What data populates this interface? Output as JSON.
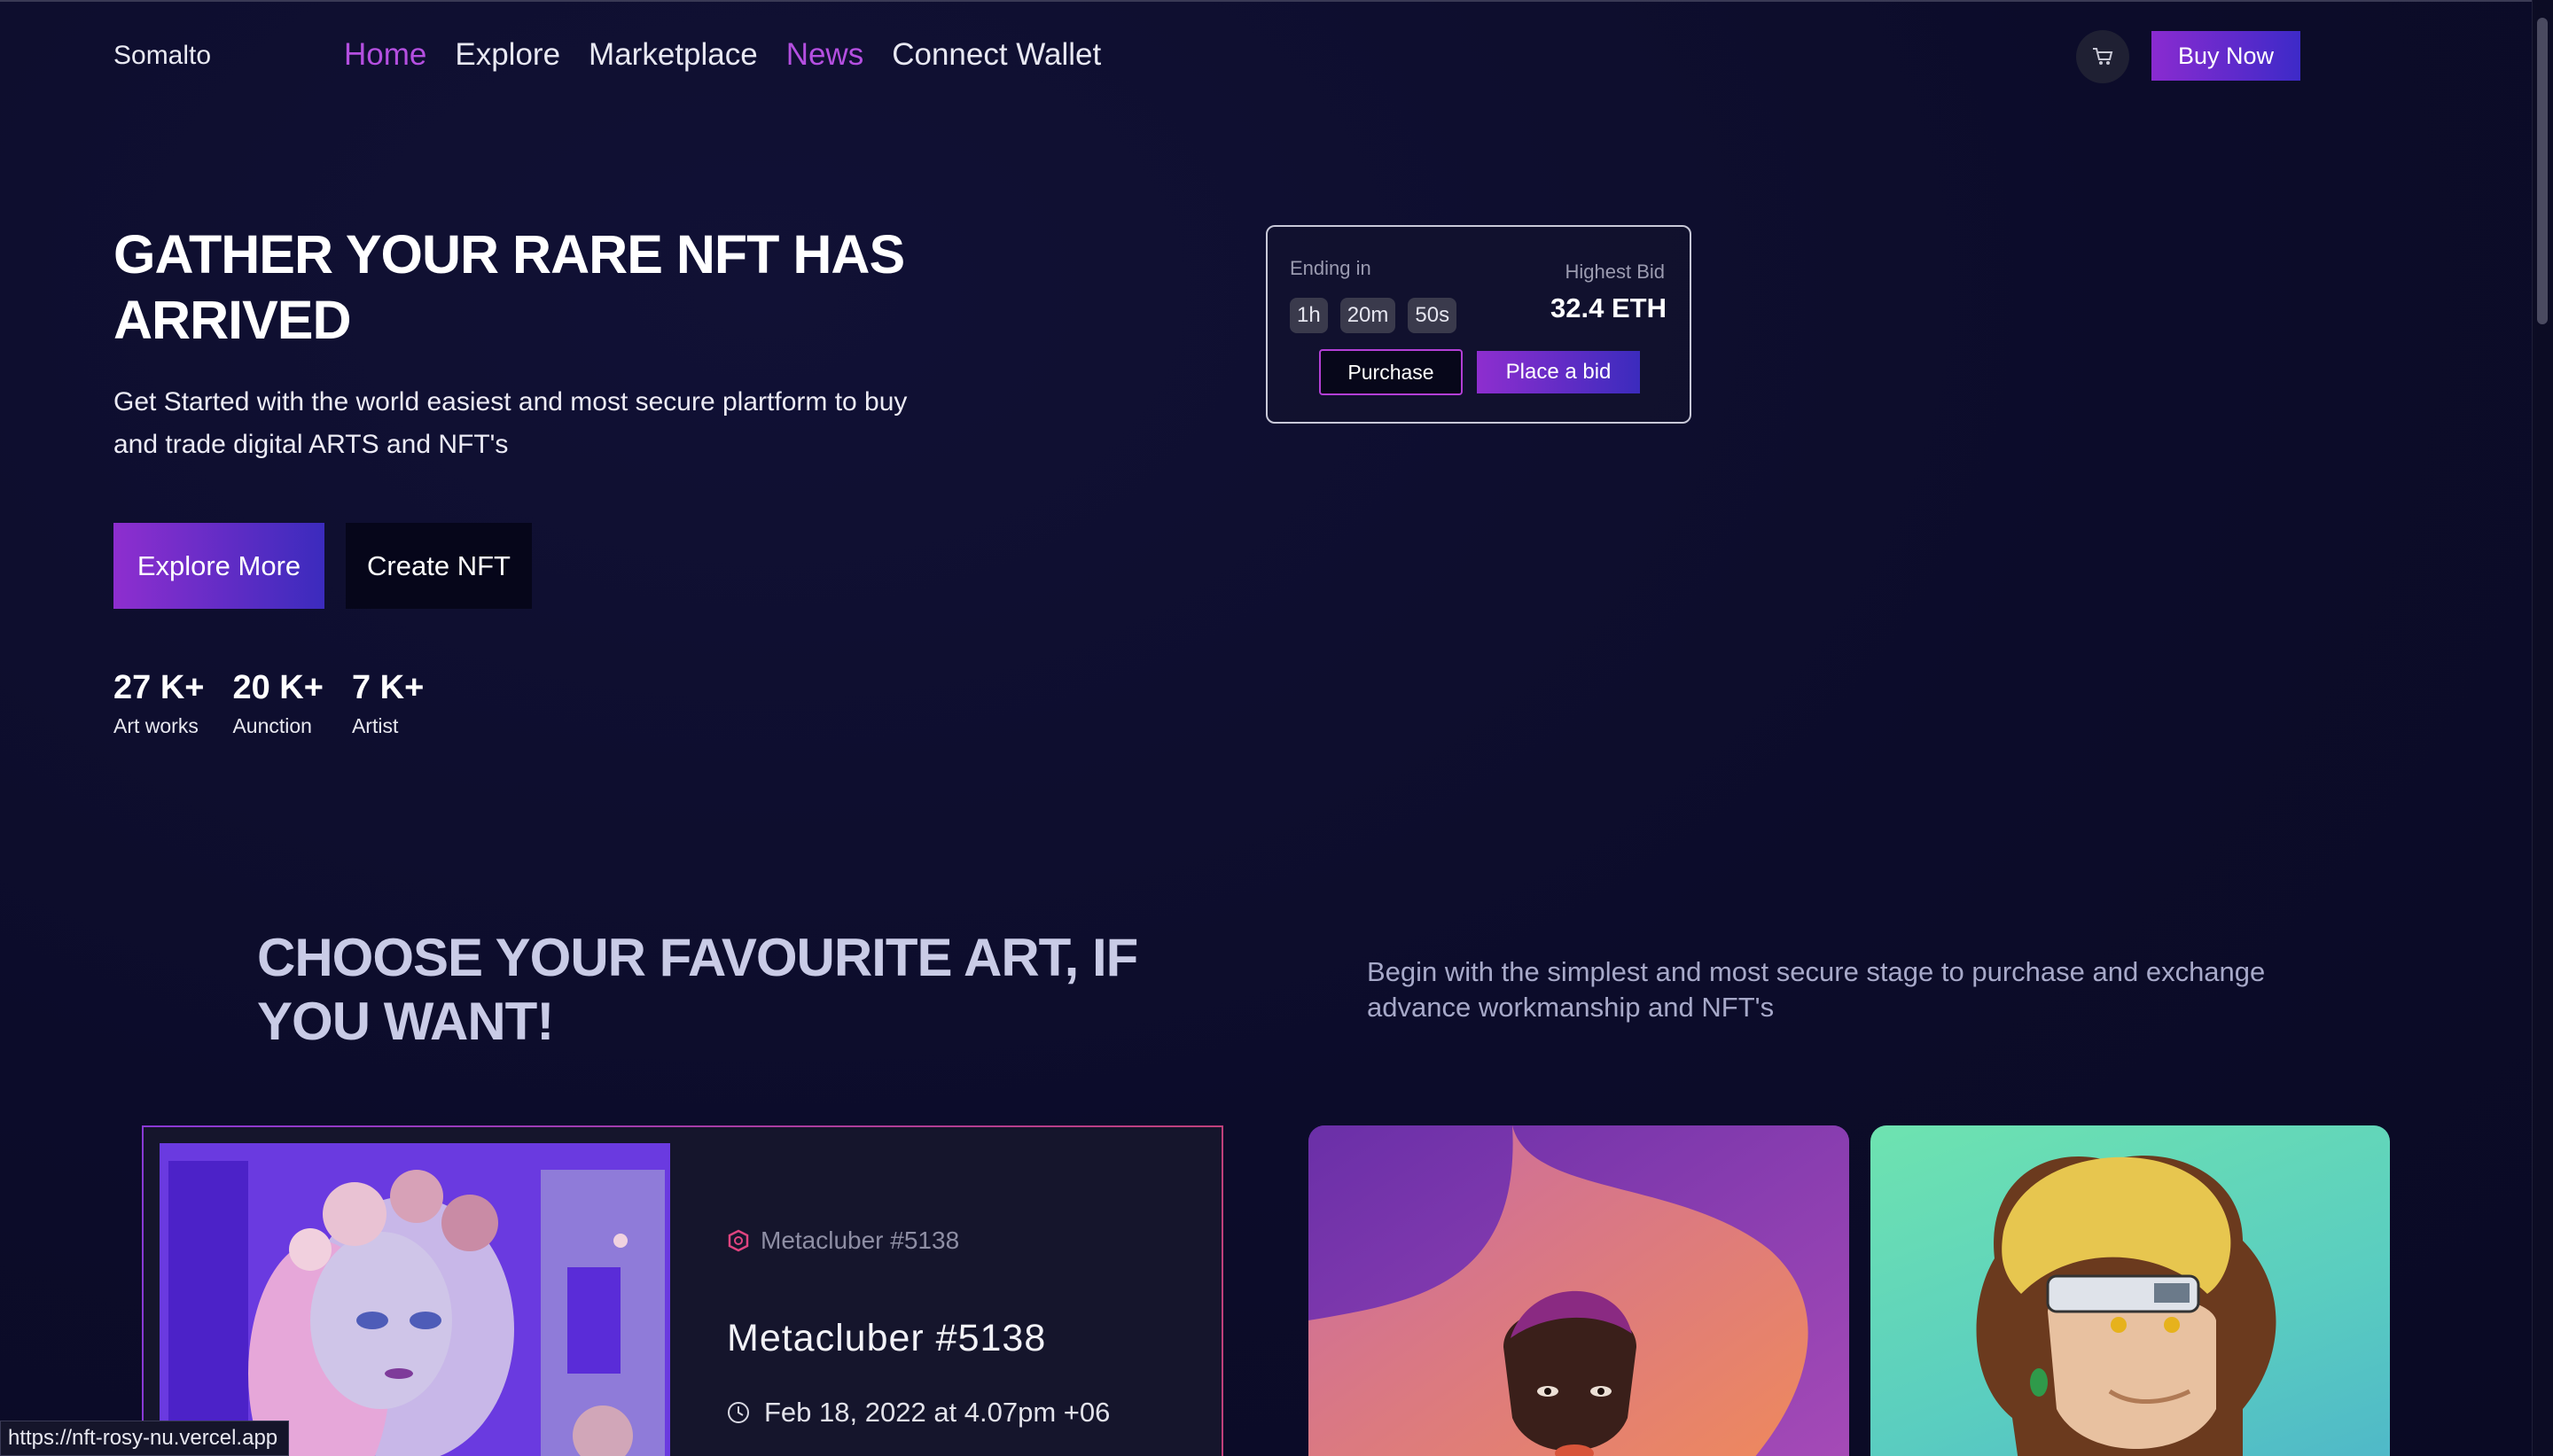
{
  "brand": "Somalto",
  "nav": {
    "items": [
      {
        "label": "Home",
        "active": true
      },
      {
        "label": "Explore",
        "active": false
      },
      {
        "label": "Marketplace",
        "active": false
      },
      {
        "label": "News",
        "active": true
      },
      {
        "label": "Connect Wallet",
        "active": false
      }
    ],
    "cart_icon": "cart-icon",
    "buy_now": "Buy Now"
  },
  "hero": {
    "title": "GATHER YOUR RARE NFT HAS ARRIVED",
    "subtitle": "Get Started with the world easiest and most secure plartform to buy and trade digital ARTS and NFT's",
    "explore_label": "Explore More",
    "create_label": "Create NFT",
    "stats": [
      {
        "value": "27 K+",
        "label": "Art works"
      },
      {
        "value": "20 K+",
        "label": "Aunction"
      },
      {
        "value": "7 K+",
        "label": "Artist"
      }
    ]
  },
  "auction": {
    "ending_label": "Ending in",
    "timer": [
      "1h",
      "20m",
      "50s"
    ],
    "highest_bid_label": "Highest Bid",
    "highest_bid_value": "32.4 ETH",
    "purchase_label": "Purchase",
    "place_bid_label": "Place a bid"
  },
  "section": {
    "title": "CHOOSE YOUR FAVOURITE ART, IF YOU WANT!",
    "subtitle": "Begin with the simplest and most secure stage to purchase and exchange advance workmanship and NFT's"
  },
  "featured": {
    "tag": "Metacluber #5138",
    "title": "Metacluber #5138",
    "date": "Feb 18, 2022 at 4.07pm +06",
    "tag_icon": "shield-gem-icon",
    "clock_icon": "clock-icon"
  },
  "status_url": "https://nft-rosy-nu.vercel.app",
  "colors": {
    "background": "#0c0c2a",
    "accent_purple": "#b44fe0",
    "gradient_start": "#8e2ecf",
    "gradient_end": "#3b2bbd"
  }
}
